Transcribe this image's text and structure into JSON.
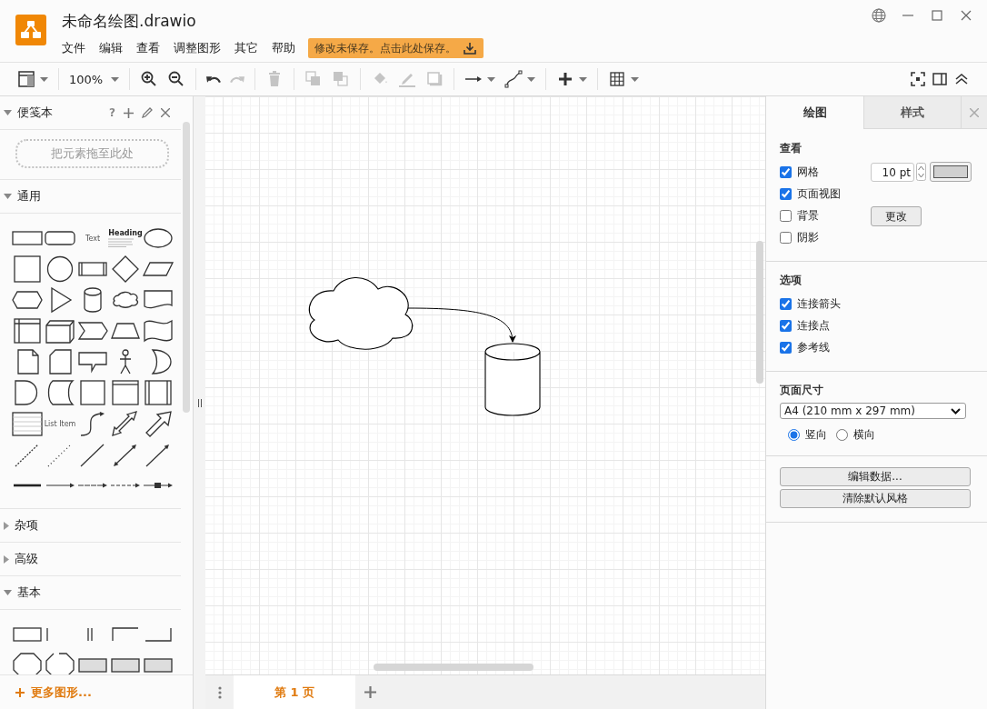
{
  "app": {
    "title": "未命名绘图.drawio",
    "menu": [
      "文件",
      "编辑",
      "查看",
      "调整图形",
      "其它",
      "帮助"
    ],
    "save_notice": "修改未保存。点击此处保存。"
  },
  "toolbar": {
    "groups": [
      [
        {
          "kind": "format",
          "disabled": false,
          "dropdown": true
        }
      ],
      [
        {
          "kind": "zoom",
          "label": "100%",
          "disabled": false,
          "dropdown": true
        }
      ],
      [
        {
          "kind": "zoom_in",
          "disabled": false
        },
        {
          "kind": "zoom_out",
          "disabled": false
        }
      ],
      [
        {
          "kind": "undo",
          "disabled": false
        },
        {
          "kind": "redo",
          "disabled": true
        }
      ],
      [
        {
          "kind": "delete",
          "disabled": true
        }
      ],
      [
        {
          "kind": "to_front",
          "disabled": true
        },
        {
          "kind": "to_back",
          "disabled": true
        }
      ],
      [
        {
          "kind": "fill",
          "disabled": true
        },
        {
          "kind": "line_color",
          "disabled": true
        },
        {
          "kind": "shadow",
          "disabled": true
        }
      ],
      [
        {
          "kind": "connection",
          "disabled": false,
          "dropdown": true
        },
        {
          "kind": "waypoints",
          "disabled": false,
          "dropdown": true
        }
      ],
      [
        {
          "kind": "insert",
          "disabled": false,
          "dropdown": true
        }
      ],
      [
        {
          "kind": "table",
          "disabled": false,
          "dropdown": true
        }
      ]
    ],
    "right_tools": [
      {
        "kind": "fullscreen",
        "disabled": false
      },
      {
        "kind": "format_toggle",
        "disabled": false
      },
      {
        "kind": "collapse",
        "disabled": false
      }
    ]
  },
  "sidebar": {
    "sections": [
      {
        "kind": "scratchpad",
        "title": "便笺本",
        "expanded": true,
        "help": "?",
        "drop_hint": "把元素拖至此处"
      },
      {
        "kind": "general",
        "title": "通用",
        "expanded": true,
        "shape_labels": [
          "Text",
          "Heading",
          "List Item"
        ]
      },
      {
        "kind": "misc",
        "title": "杂项",
        "expanded": false
      },
      {
        "kind": "advanced",
        "title": "高级",
        "expanded": false
      },
      {
        "kind": "basic",
        "title": "基本",
        "expanded": true
      }
    ],
    "more_shapes": "更多图形..."
  },
  "format_panel": {
    "tabs": [
      {
        "label": "绘图",
        "selected": true
      },
      {
        "label": "样式",
        "selected": false
      }
    ],
    "view": {
      "title": "查看",
      "options": [
        {
          "label": "网格",
          "checked": true
        },
        {
          "label": "页面视图",
          "checked": true
        },
        {
          "label": "背景",
          "checked": false
        },
        {
          "label": "阴影",
          "checked": false
        }
      ],
      "grid_size": "10 pt",
      "change_button": "更改"
    },
    "options": {
      "title": "选项",
      "options": [
        {
          "label": "连接箭头",
          "checked": true
        },
        {
          "label": "连接点",
          "checked": true
        },
        {
          "label": "参考线",
          "checked": true
        }
      ]
    },
    "page_size": {
      "title": "页面尺寸",
      "value": "A4 (210 mm x 297 mm)",
      "orientations": [
        {
          "label": "竖向",
          "selected": true
        },
        {
          "label": "横向",
          "selected": false
        }
      ]
    },
    "buttons": [
      "编辑数据...",
      "清除默认风格"
    ]
  },
  "pages": [
    {
      "label": "第 1 页",
      "selected": true
    }
  ]
}
